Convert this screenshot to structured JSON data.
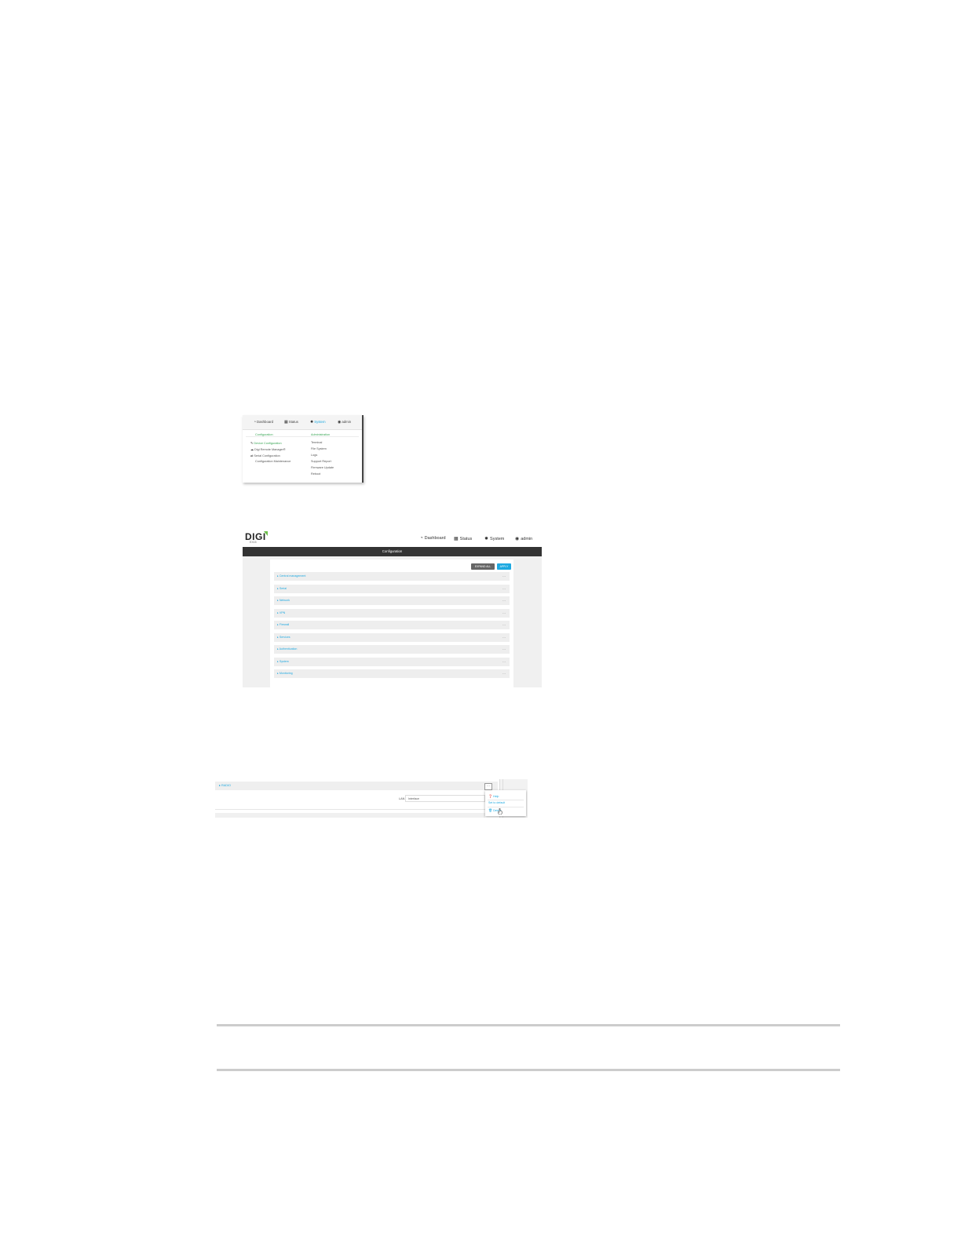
{
  "screenshot1": {
    "nav": {
      "dashboard": "Dashboard",
      "status": "Status",
      "system": "System",
      "admin": "admin"
    },
    "configuration": {
      "heading": "Configuration",
      "items": [
        "Device Configuration",
        "Digi Remote Manager®",
        "Serial Configuration",
        "Configuration Maintenance"
      ]
    },
    "administration": {
      "heading": "Administration",
      "items": [
        "Terminal",
        "File System",
        "Logs",
        "Support Report",
        "Firmware Update",
        "Reboot"
      ]
    }
  },
  "screenshot2": {
    "logo": "DIGI",
    "logo_sub": "EX15",
    "nav": {
      "dashboard": "Dashboard",
      "status": "Status",
      "system": "System",
      "admin": "admin"
    },
    "title": "Configuration",
    "expand_all": "EXPAND ALL",
    "apply": "APPLY",
    "sections": [
      "Central management",
      "Serial",
      "Network",
      "VPN",
      "Firewall",
      "Services",
      "Authentication",
      "System",
      "Monitoring"
    ]
  },
  "screenshot3": {
    "item_label": "RADIO",
    "field_label": "LAN",
    "field_value": "Interface",
    "menu_button": "⋯",
    "menu": {
      "help": "Help",
      "set_default": "Set to default",
      "delete": "Delete"
    }
  },
  "colors": {
    "accent": "#1ea9e1",
    "green": "#3aa655",
    "dark": "#333333"
  }
}
